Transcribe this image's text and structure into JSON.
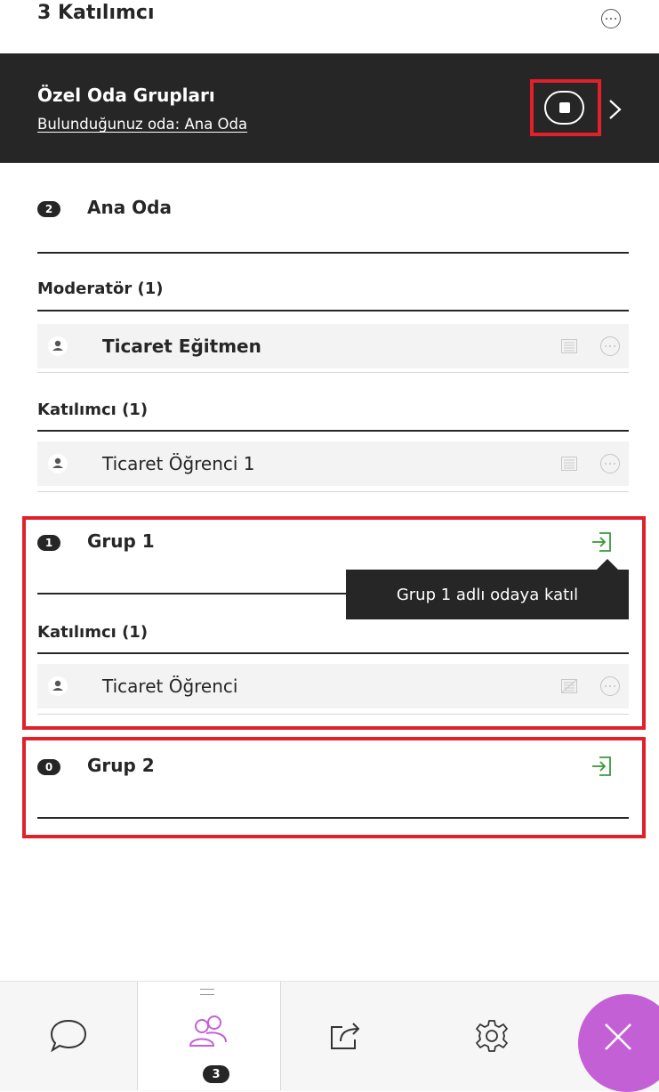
{
  "header": {
    "title": "3 Katılımcı",
    "more_icon": "more-dots-icon"
  },
  "breakout": {
    "title": "Özel Oda Grupları",
    "current_room": "Bulunduğunuz oda: Ana Oda",
    "stop_icon": "stop-circle-icon",
    "next_icon": "chevron-right-icon"
  },
  "main_room": {
    "badge": "2",
    "name": "Ana Oda",
    "moderators_title": "Moderatör (1)",
    "moderator_name": "Ticaret Eğitmen",
    "participants_title": "Katılımcı (1)",
    "participant_name": "Ticaret Öğrenci 1"
  },
  "group1": {
    "badge": "1",
    "name": "Grup 1",
    "join_icon": "join-room-icon",
    "tooltip": "Grup 1 adlı odaya katıl",
    "participants_title": "Katılımcı (1)",
    "participant_name": "Ticaret Öğrenci"
  },
  "group2": {
    "badge": "0",
    "name": "Grup 2",
    "join_icon": "join-room-icon"
  },
  "bottom_bar": {
    "tabs": [
      {
        "icon": "chat-icon"
      },
      {
        "icon": "participants-icon",
        "badge": "3"
      },
      {
        "icon": "share-icon"
      },
      {
        "icon": "settings-icon"
      }
    ],
    "close_icon": "close-icon"
  },
  "colors": {
    "dark": "#262626",
    "highlight_red": "#e0202a",
    "join_green": "#3a9a3a",
    "accent_purple": "#c460d6"
  }
}
